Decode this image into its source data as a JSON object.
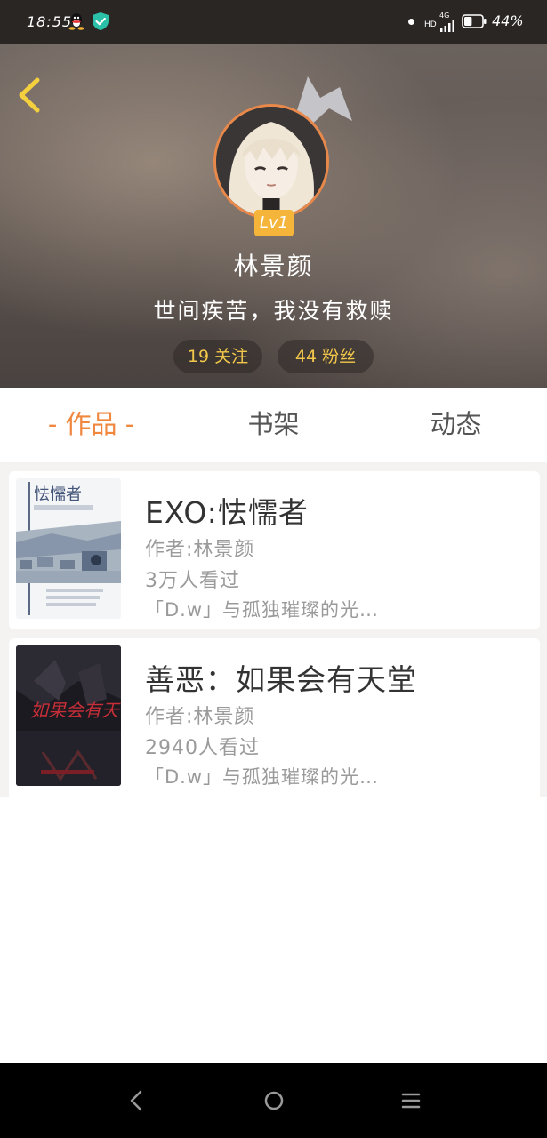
{
  "status_bar": {
    "time": "18:55",
    "network_hd": "HD",
    "network_type": "4G",
    "battery_percent": "44%",
    "battery_level": 0.44,
    "icons": [
      "qq-icon",
      "shield-check-icon",
      "notification-dot-icon",
      "signal-icon",
      "battery-icon"
    ]
  },
  "header": {
    "back_icon": "chevron-left-icon",
    "level_badge": "Lv1",
    "username": "林景颜",
    "bio": "世间疾苦，我没有救赎",
    "following_label": "19 关注",
    "fans_label": "44 粉丝"
  },
  "tabs": [
    {
      "label": "- 作品 -",
      "active": true
    },
    {
      "label": "书架",
      "active": false
    },
    {
      "label": "动态",
      "active": false
    }
  ],
  "works": [
    {
      "title": "EXO:怯懦者",
      "author": "作者:林景颜",
      "views": "3万人看过",
      "description": "「D.w」与孤独璀璨的光…"
    },
    {
      "title": "善恶：如果会有天堂",
      "author": "作者:林景颜",
      "views": "2940人看过",
      "description": "「D.w」与孤独璀璨的光…"
    }
  ],
  "cover_texts": {
    "cover1_title": "怯懦者",
    "cover2_title": "如果会有天堂"
  },
  "colors": {
    "accent": "#f0873f",
    "level_badge": "#f4b53a",
    "stat_text": "#f3c84a",
    "avatar_border": "#e8884a"
  },
  "nav_bar": {
    "icons": [
      "nav-back-icon",
      "nav-home-icon",
      "nav-menu-icon"
    ]
  }
}
